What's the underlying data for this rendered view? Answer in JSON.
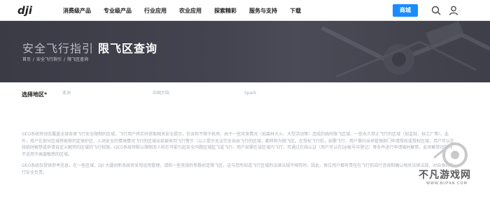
{
  "nav": {
    "logo_text": "dji",
    "links": [
      "消费级产品",
      "专业级产品",
      "行业应用",
      "农业应用",
      "探索精彩",
      "服务与支持",
      "下载"
    ],
    "shop_label": "商城",
    "icons": [
      "search-icon",
      "user-icon"
    ],
    "accent_color": "#1a8cff"
  },
  "hero": {
    "title_light": "安全飞行指引",
    "title_strong": "限飞区查询",
    "breadcrumb": [
      "首页",
      "安全飞行指引",
      "限飞区查询"
    ],
    "breadcrumb_sep": "/"
  },
  "region": {
    "label": "选择地区*",
    "selects": [
      "亚洲",
      "中国大陆",
      "Spark"
    ]
  },
  "content": {
    "para1": "GEO系统将动态覆盖全球各类飞行安全限制的区域，飞行用户将实时获取相关安全提示，包含但不限于机场、由于一些突发情况（如森林大火、大型活动等）造成的临时限飞区域、一些永久禁止飞行的区域（如监狱、核工厂等）。此外，用户在部分区域将能够判定保护区，入场安全的情境情况飞行的区域出现被收到飞行警示（以上提示无法完全自由飞行的区域，都将称为限飞区。在授权飞行前，如需飞行，用户需向当地管理部门申请授权或授权区域，用户可以在线临时解禁或申请自定义解禁的区域的飞行权限。GEO系统将默认限制无人机在可能引起安全问题区域起飞或飞行。用户如需在该区域内飞行，可通过在线认证（用户可以在DJI账号中登记）等条件进行申请临时解禁。此项解禁功能并不适用于高度敏感的区域。",
    "para2": "GEO系统仅提供参考信息，在一些区域，DJI 大疆创新系统将采用适用管理，请和一些常规的参数初定限飞区，这与您所知道飞行区域的法律法规不相符时。因此，每位用户都有责任在飞行前自行咨询和确认相关法律法规，对自身的飞行安全负责。"
  },
  "watermark": {
    "title": "不凡游戏网",
    "url": "WWW.BUFAN.COM"
  }
}
